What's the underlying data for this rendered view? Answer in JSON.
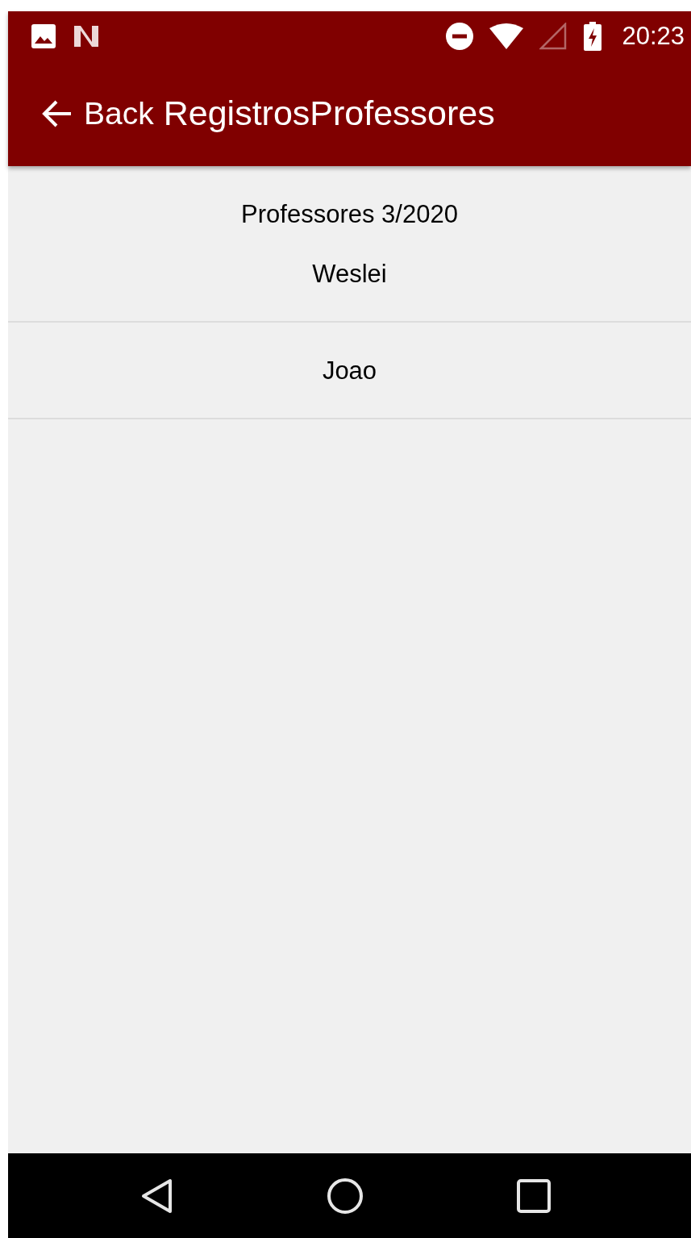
{
  "status_bar": {
    "time": "20:23"
  },
  "app_bar": {
    "back_label": "Back",
    "title": "RegistrosProfessores"
  },
  "list": {
    "heading": "Professores 3/2020",
    "rows": [
      {
        "name": "Weslei"
      },
      {
        "name": "Joao"
      }
    ]
  }
}
